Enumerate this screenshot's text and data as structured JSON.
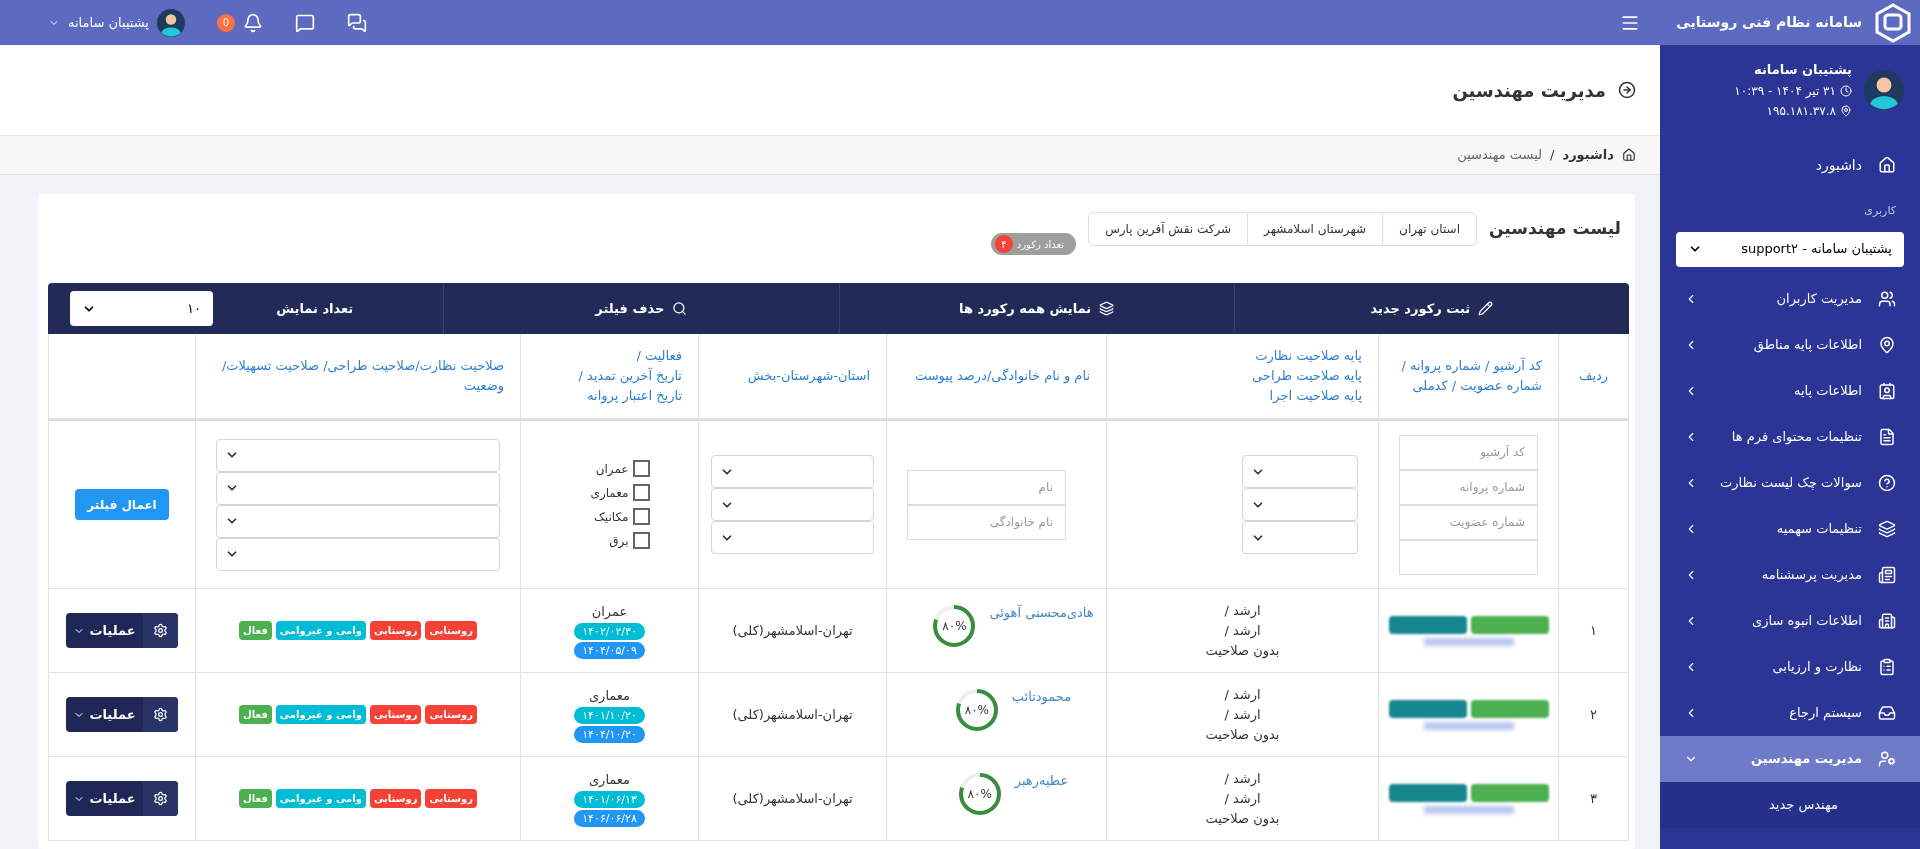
{
  "brand": {
    "title": "سامانه نظام فنی روستایی"
  },
  "topbar": {
    "user_name": "پشتیبان سامانه",
    "notifications_count": "0"
  },
  "sidebar": {
    "user": {
      "name": "پشتیبان سامانه",
      "date_time": "۳۱ تیر ۱۴۰۴ - ۱۰:۳۹",
      "ip": "۱۹۵.۱۸۱.۳۷.۸"
    },
    "dashboard": "داشبورد",
    "section_label": "کاربری",
    "role_select": "پشتیبان سامانه - support۲",
    "items": [
      {
        "label": "مدیریت کاربران",
        "selected": false,
        "expanded": false
      },
      {
        "label": "اطلاعات پایه مناطق",
        "selected": false,
        "expanded": false
      },
      {
        "label": "اطلاعات پایه",
        "selected": false,
        "expanded": false
      },
      {
        "label": "تنظیمات محتوای فرم ها",
        "selected": false,
        "expanded": false
      },
      {
        "label": "سوالات چک لیست نظارت",
        "selected": false,
        "expanded": false
      },
      {
        "label": "تنظیمات سهمیه",
        "selected": false,
        "expanded": false
      },
      {
        "label": "مدیریت پرسشنامه",
        "selected": false,
        "expanded": false
      },
      {
        "label": "اطلاعات انبوه سازی",
        "selected": false,
        "expanded": false
      },
      {
        "label": "نظارت و ارزیابی",
        "selected": false,
        "expanded": false
      },
      {
        "label": "سیستم ارجاع",
        "selected": false,
        "expanded": false
      },
      {
        "label": "مدیریت مهندسین",
        "selected": true,
        "expanded": true,
        "children": [
          {
            "label": "مهندس جدید"
          }
        ]
      }
    ]
  },
  "page": {
    "title": "مدیریت مهندسین",
    "separator": "/",
    "breadcrumb": [
      {
        "label": "داشبورد"
      },
      {
        "label": "لیست مهندسین"
      }
    ]
  },
  "card": {
    "title": "لیست مهندسین",
    "scopes": [
      "استان تهران",
      "شهرستان اسلامشهر",
      "شرکت نقش آفرین پارس"
    ],
    "record_count_label": "تعداد رکورد",
    "record_count": "۴"
  },
  "toolbar": {
    "new_record": "ثبت رکورد جدید",
    "show_all": "نمایش همه رکورد ها",
    "remove_filter": "حذف فیلتر",
    "page_size_label": "تعداد نمایش",
    "page_size": "۱۰"
  },
  "columns": [
    {
      "lines": [
        "ردیف"
      ]
    },
    {
      "lines": [
        "کد آرشیو / شماره پروانه / شماره عضویت / کدملی"
      ]
    },
    {
      "lines": [
        "پایه صلاحیت نظارت",
        "پایه صلاحیت طراحی",
        "پایه صلاحیت اجرا"
      ]
    },
    {
      "lines": [
        "نام و نام خانوادگی/درصد پیوست"
      ]
    },
    {
      "lines": [
        "استان-شهرستان-بخش"
      ]
    },
    {
      "lines": [
        "فعالیت /",
        "تاریخ آخرین تمدید /",
        "تاریخ اعتبار پروانه"
      ]
    },
    {
      "lines": [
        "صلاحیت نظارت/صلاحیت طراحی/ صلاحیت تسهیلات/ وضعیت"
      ]
    }
  ],
  "filters": {
    "code_fields": [
      {
        "kind": "text",
        "placeholder": "کد آرشیو"
      },
      {
        "kind": "text",
        "placeholder": "شماره پروانه"
      },
      {
        "kind": "text",
        "placeholder": "شماره عضویت"
      },
      {
        "kind": "text"
      }
    ],
    "base_selects": [
      {
        "kind": "select"
      },
      {
        "kind": "select"
      },
      {
        "kind": "select"
      }
    ],
    "name_fields": [
      {
        "kind": "text",
        "placeholder": "نام"
      },
      {
        "kind": "text",
        "placeholder": "نام خانوادگی"
      }
    ],
    "location_selects": [
      {
        "kind": "select"
      },
      {
        "kind": "select"
      },
      {
        "kind": "select"
      }
    ],
    "activities": [
      {
        "label": "عمران",
        "checked": false
      },
      {
        "label": "معماری",
        "checked": false
      },
      {
        "label": "مکانیک",
        "checked": false
      },
      {
        "label": "برق",
        "checked": false
      }
    ],
    "competency_selects": [
      {
        "kind": "select"
      },
      {
        "kind": "select"
      },
      {
        "kind": "select"
      },
      {
        "kind": "select"
      }
    ],
    "apply": "اعمال فیلتر"
  },
  "rows": [
    {
      "index": "۱",
      "base": [
        "ارشد /",
        "ارشد /",
        "بدون صلاحیت"
      ],
      "name": "هادی‌محسنی آهوئی",
      "attachment": "۸۰%",
      "level": 0.8,
      "location": "تهران-اسلامشهر(کلی)",
      "activity": "عمران",
      "dates": [
        {
          "text": "۱۴۰۲/۰۲/۳۰",
          "color": "#00bcd4"
        },
        {
          "text": "۱۴۰۴/۰۵/۰۹",
          "color": "#2196f3"
        }
      ],
      "tags": [
        {
          "label": "روستایی",
          "color": "#f44336"
        },
        {
          "label": "روستایی",
          "color": "#f44336"
        },
        {
          "label": "وامی و غیروامی",
          "color": "#00bcd4"
        },
        {
          "label": "فعال",
          "color": "#4caf50"
        }
      ],
      "actions": "عملیات"
    },
    {
      "index": "۲",
      "base": [
        "ارشد /",
        "ارشد /",
        "بدون صلاحیت"
      ],
      "name": "محمودتائب",
      "attachment": "۸۰%",
      "level": 0.8,
      "location": "تهران-اسلامشهر(کلی)",
      "activity": "معماری",
      "dates": [
        {
          "text": "۱۴۰۱/۱۰/۲۰",
          "color": "#00bcd4"
        },
        {
          "text": "۱۴۰۴/۱۰/۲۰",
          "color": "#2196f3"
        }
      ],
      "tags": [
        {
          "label": "روستایی",
          "color": "#f44336"
        },
        {
          "label": "روستایی",
          "color": "#f44336"
        },
        {
          "label": "وامی و غیروامی",
          "color": "#00bcd4"
        },
        {
          "label": "فعال",
          "color": "#4caf50"
        }
      ],
      "actions": "عملیات"
    },
    {
      "index": "۳",
      "base": [
        "ارشد /",
        "ارشد /",
        "بدون صلاحیت"
      ],
      "name": "عطیه‌رهبر",
      "attachment": "۸۰%",
      "level": 0.8,
      "location": "تهران-اسلامشهر(کلی)",
      "activity": "معماری",
      "dates": [
        {
          "text": "۱۴۰۱/۰۶/۱۳",
          "color": "#00bcd4"
        },
        {
          "text": "۱۴۰۶/۰۶/۲۸",
          "color": "#2196f3"
        }
      ],
      "tags": [
        {
          "label": "روستایی",
          "color": "#f44336"
        },
        {
          "label": "روستایی",
          "color": "#f44336"
        },
        {
          "label": "وامی و غیروامی",
          "color": "#00bcd4"
        },
        {
          "label": "فعال",
          "color": "#4caf50"
        }
      ],
      "actions": "عملیات"
    }
  ]
}
